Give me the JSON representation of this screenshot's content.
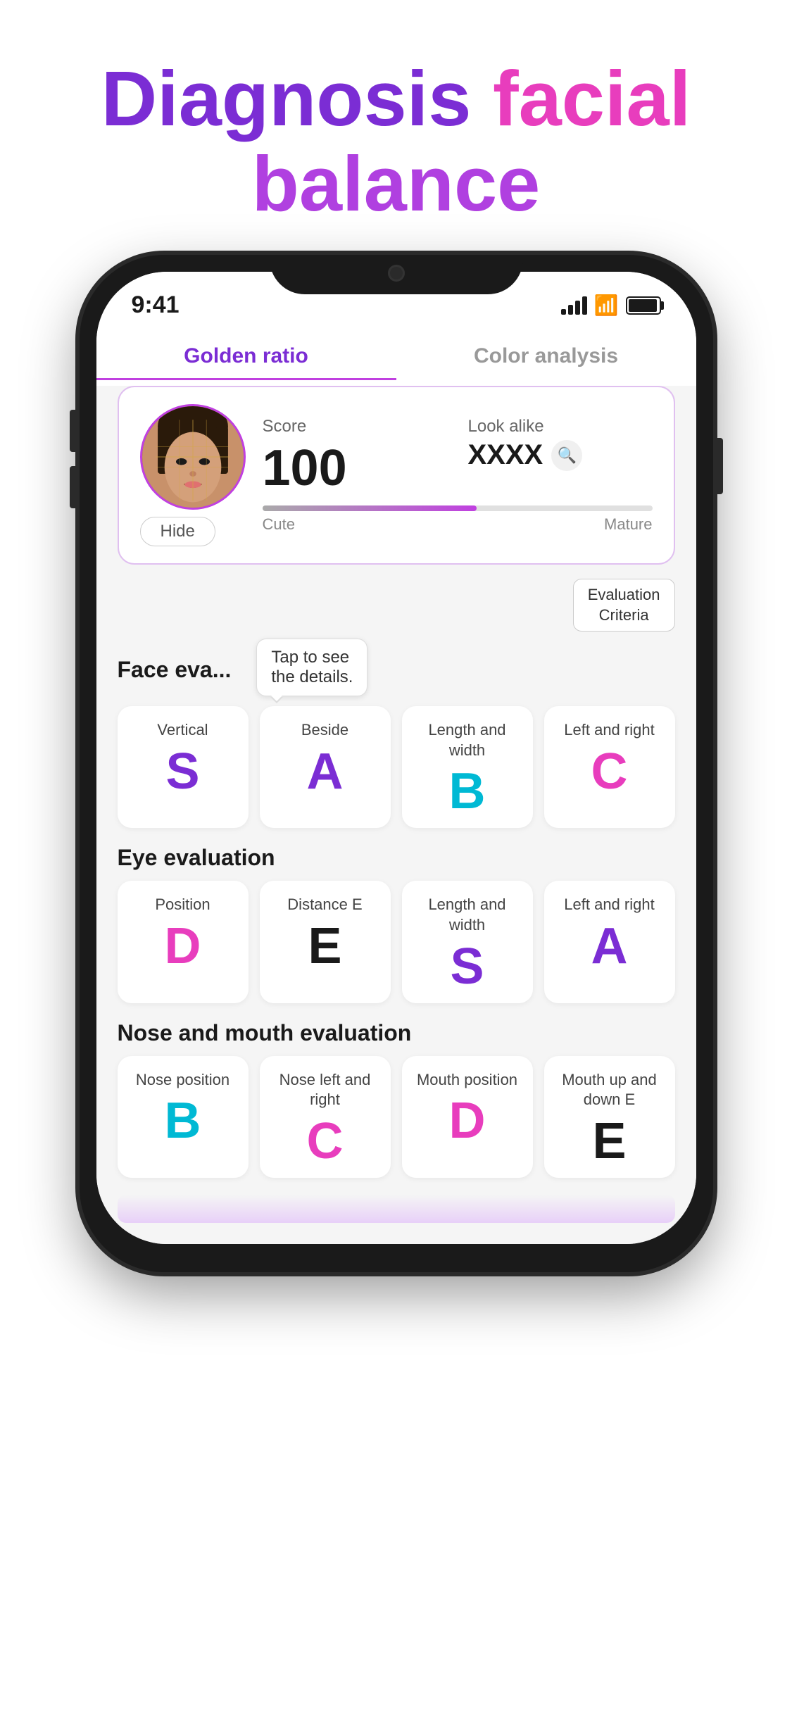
{
  "headline": {
    "line1": "Diagnosis facial",
    "line2": "balance"
  },
  "status_bar": {
    "time": "9:41",
    "signal": "4 bars",
    "wifi": true,
    "battery": "full"
  },
  "tabs": [
    {
      "id": "golden-ratio",
      "label": "Golden ratio",
      "active": true
    },
    {
      "id": "color-analysis",
      "label": "Color analysis",
      "active": false
    }
  ],
  "score_card": {
    "score_label": "Score",
    "score_value": "100",
    "look_alike_label": "Look alike",
    "look_alike_value": "XXXX",
    "hide_btn": "Hide",
    "bar_left_label": "Cute",
    "bar_right_label": "Mature"
  },
  "eval_criteria_btn": [
    "Evaluation",
    "Criteria"
  ],
  "tooltip": "Tap to see\nthe details.",
  "face_evaluation": {
    "section_title": "Face eva...",
    "cards": [
      {
        "label": "Vertical",
        "grade": "S",
        "grade_class": "grade-s"
      },
      {
        "label": "Beside",
        "grade": "A",
        "grade_class": "grade-a"
      },
      {
        "label": "Length and width",
        "grade": "B",
        "grade_class": "grade-b"
      },
      {
        "label": "Left and right",
        "grade": "C",
        "grade_class": "grade-c"
      }
    ]
  },
  "eye_evaluation": {
    "section_title": "Eye evaluation",
    "cards": [
      {
        "label": "Position",
        "grade": "D",
        "grade_class": "grade-d"
      },
      {
        "label": "Distance E",
        "grade": "E",
        "grade_class": "grade-e"
      },
      {
        "label": "Length and width",
        "grade": "S",
        "grade_class": "grade-s"
      },
      {
        "label": "Left and right",
        "grade": "A",
        "grade_class": "grade-a"
      }
    ]
  },
  "nose_mouth_evaluation": {
    "section_title": "Nose and mouth evaluation",
    "cards": [
      {
        "label": "Nose position",
        "grade": "B",
        "grade_class": "grade-b"
      },
      {
        "label": "Nose left and right",
        "grade": "C",
        "grade_class": "grade-c"
      },
      {
        "label": "Mouth position",
        "grade": "D",
        "grade_class": "grade-d"
      },
      {
        "label": "Mouth up and down E",
        "grade": "E",
        "grade_class": "grade-e"
      }
    ]
  }
}
